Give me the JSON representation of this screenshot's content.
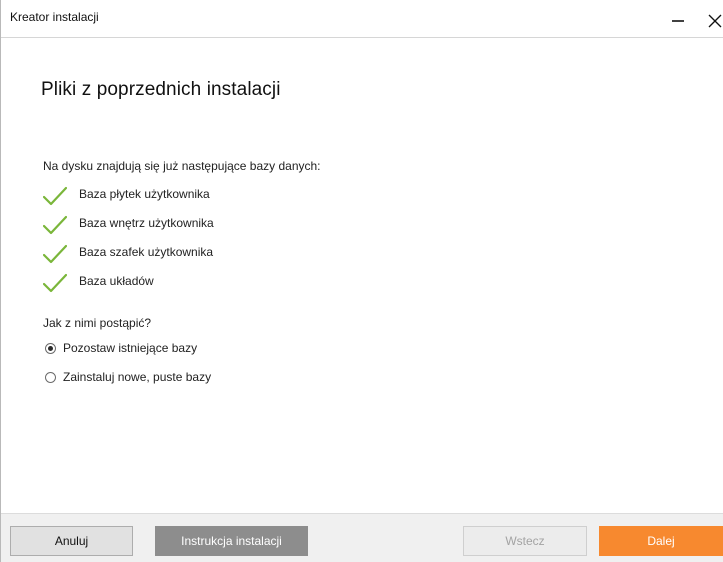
{
  "window": {
    "title": "Kreator instalacji"
  },
  "page": {
    "heading": "Pliki z poprzednich instalacji",
    "intro": "Na dysku znajdują się już następujące bazy danych:",
    "databases": [
      {
        "label": "Baza płytek użytkownika",
        "icon": "check-icon"
      },
      {
        "label": "Baza wnętrz użytkownika",
        "icon": "check-icon"
      },
      {
        "label": "Baza szafek użytkownika",
        "icon": "check-icon"
      },
      {
        "label": "Baza układów",
        "icon": "check-icon"
      }
    ],
    "question": "Jak z nimi postąpić?",
    "options": [
      {
        "label": "Pozostaw istniejące bazy",
        "selected": true
      },
      {
        "label": "Zainstaluj nowe, puste bazy",
        "selected": false
      }
    ]
  },
  "footer": {
    "cancel_label": "Anuluj",
    "guide_label": "Instrukcja instalacji",
    "back_label": "Wstecz",
    "next_label": "Dalej"
  },
  "colors": {
    "accent": "#f7892f",
    "check": "#7ab63a",
    "guide_button": "#8d8d8d"
  }
}
